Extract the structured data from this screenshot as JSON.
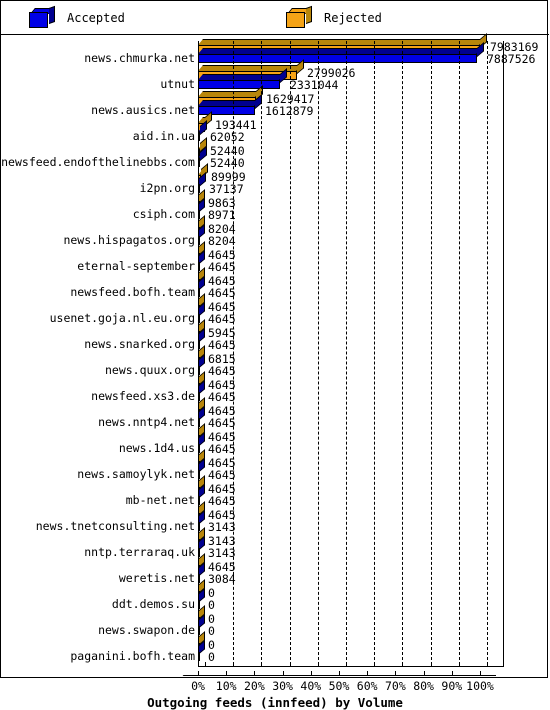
{
  "legend": {
    "items": [
      {
        "label": "Accepted",
        "color": "#0000E6",
        "icon": "cube-icon"
      },
      {
        "label": "Rejected",
        "color": "#F5A316",
        "icon": "cube-icon"
      }
    ]
  },
  "axis": {
    "title": "Outgoing feeds (innfeed) by Volume",
    "ticks": [
      "0%",
      "10%",
      "20%",
      "30%",
      "40%",
      "50%",
      "60%",
      "70%",
      "80%",
      "90%",
      "100%"
    ]
  },
  "chart_data": {
    "type": "bar",
    "orientation": "horizontal",
    "title": "Outgoing feeds (innfeed) by Volume",
    "xlabel": "Outgoing feeds (innfeed) by Volume",
    "ylabel": "",
    "xlim": [
      0,
      100
    ],
    "xunit": "%",
    "xticks": [
      0,
      10,
      20,
      30,
      40,
      50,
      60,
      70,
      80,
      90,
      100
    ],
    "grid": true,
    "legend_position": "top",
    "normalization": "each bar scaled as percent of maximum value (7983169)",
    "max_value": 7983169,
    "categories": [
      "news.chmurka.net",
      "utnut",
      "news.ausics.net",
      "aid.in.ua",
      "newsfeed.endofthelinebbs.com",
      "i2pn.org",
      "csiph.com",
      "news.hispagatos.org",
      "eternal-september",
      "newsfeed.bofh.team",
      "usenet.goja.nl.eu.org",
      "news.snarked.org",
      "news.quux.org",
      "newsfeed.xs3.de",
      "news.nntp4.net",
      "news.1d4.us",
      "news.samoylyk.net",
      "mb-net.net",
      "news.tnetconsulting.net",
      "nntp.terraraq.uk",
      "weretis.net",
      "ddt.demos.su",
      "news.swapon.de",
      "paganini.bofh.team"
    ],
    "series": [
      {
        "name": "Rejected",
        "color": "#F5A316",
        "values": [
          7983169,
          2799026,
          1629417,
          193441,
          52440,
          89999,
          9863,
          8204,
          4645,
          4645,
          4645,
          5945,
          6815,
          4645,
          4645,
          4645,
          4645,
          4645,
          4645,
          3143,
          4645,
          0,
          0,
          0
        ]
      },
      {
        "name": "Accepted",
        "color": "#0000E6",
        "values": [
          7887526,
          2331044,
          1612879,
          62052,
          52440,
          37137,
          8971,
          8204,
          4645,
          4645,
          4645,
          4645,
          4645,
          4645,
          4645,
          4645,
          4645,
          4645,
          3143,
          3143,
          3084,
          0,
          0,
          0
        ]
      }
    ]
  }
}
